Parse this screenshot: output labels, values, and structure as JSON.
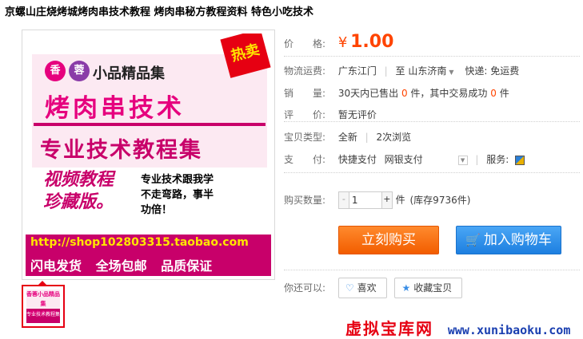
{
  "title": "京螺山庄烧烤城烤肉串技术教程 烤肉串秘方教程资料 特色小吃技术",
  "poster": {
    "circle1": "香",
    "circle2": "蓉",
    "series": "小品精品集",
    "hot": "热卖",
    "headline": "烤肉串技术",
    "subheadline": "专业技术教程集",
    "video_line1": "视频教程",
    "video_line2": "珍藏版。",
    "slogan_line1": "专业技术跟我学",
    "slogan_line2": "不走弯路，事半",
    "slogan_line3": "功倍！",
    "url": "http://shop102803315.taobao.com",
    "features": "闪电发货 全场包邮 品质保证"
  },
  "thumbnail": {
    "line1": "香蓉小品精品集",
    "line2": "烤肉串技术",
    "line3": "专业技术教程集"
  },
  "price": {
    "label": "价　　格:",
    "symbol": "¥",
    "value": "1.00"
  },
  "shipping": {
    "label": "物流运费:",
    "from": "广东江门",
    "divider": "至",
    "to": "山东济南",
    "express": "快递: 免运费"
  },
  "sales": {
    "label": "销　　量:",
    "prefix": "30天内已售出",
    "sold": "0",
    "mid": "件，其中交易成功",
    "success": "0",
    "suffix": "件"
  },
  "review": {
    "label": "评　　价:",
    "value": "暂无评价"
  },
  "type": {
    "label": "宝贝类型:",
    "condition": "全新",
    "views": "2次浏览"
  },
  "payment": {
    "label": "支　　付:",
    "method1": "快捷支付",
    "method2": "网银支付",
    "service_label": "服务:"
  },
  "quantity": {
    "label": "购买数量:",
    "value": "1",
    "unit": "件",
    "stock": "(库存9736件)",
    "minus": "-",
    "plus": "+"
  },
  "actions": {
    "buy_now": "立刻购买",
    "add_cart": "加入购物车"
  },
  "also": {
    "label": "你还可以:",
    "like": "喜欢",
    "favorite": "收藏宝贝"
  },
  "watermark": {
    "cn": "虚拟宝库网",
    "url": "www.xunibaoku.com"
  },
  "colors": {
    "accent_orange": "#ff4400",
    "buy_button": "#f25d00",
    "cart_button": "#1d7fe0",
    "poster_magenta": "#c8006a"
  }
}
